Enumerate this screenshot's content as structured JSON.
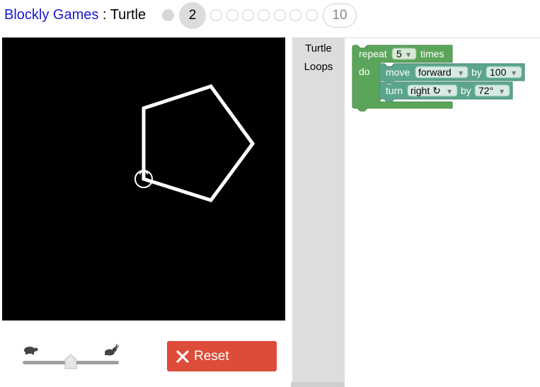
{
  "header": {
    "app_name": "Blockly Games",
    "separator": " : ",
    "game_name": "Turtle",
    "current_level": "2",
    "last_level": "10"
  },
  "canvas": {
    "background": "#000000",
    "stroke": "#ffffff",
    "shape": "pentagon",
    "turtle_icon": "turtle-cursor-icon"
  },
  "controls": {
    "speed_slow_icon": "turtle-icon",
    "speed_fast_icon": "rabbit-icon",
    "speed_level": 0.5,
    "reset_label": "Reset",
    "reset_color": "#dd4b39"
  },
  "toolbox": {
    "categories": [
      "Turtle",
      "Loops"
    ]
  },
  "workspace": {
    "repeat_block": {
      "label_repeat": "repeat",
      "count": "5",
      "label_times": "times",
      "label_do": "do",
      "color": "#5ba55b"
    },
    "move_block": {
      "label_move": "move",
      "direction": "forward",
      "label_by": "by",
      "distance": "100",
      "color": "#5ba58c"
    },
    "turn_block": {
      "label_turn": "turn",
      "direction": "right ↻",
      "label_by": "by",
      "angle": "72°",
      "color": "#5ba58c"
    }
  }
}
